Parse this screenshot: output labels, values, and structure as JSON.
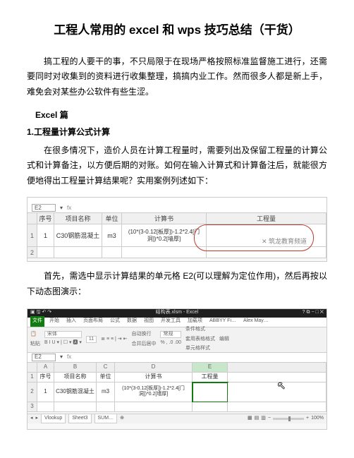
{
  "title": "工程人常用的 excel 和 wps 技巧总结（干货）",
  "para1": "搞工程的人要干的事，不只局限于在现场严格按照标准监督施工进行，还需要同时对收集到的资料进行收集整理，搞搞内业工作。然而很多人都是新上手，难免会对某些办公软件有些生涩。",
  "section1": "Excel 篇",
  "subsection1": "1.工程量计算公式计算",
  "para2": "在很多情况下，造价人员在计算工程量时，需要列出及保留工程量的计算公式和计算备注，以方便后期的对账。如何在输入计算式和计算备注后，就能很方便地得出工程量计算结果呢？实用案例列述如下：",
  "para3": "首先，需选中显示计算结果的单元格 E2(可以理解为定位作用)，然后再按以下动态图演示：",
  "ss1": {
    "cellref": "E2",
    "headers": [
      "序号",
      "项目名称",
      "单位",
      "计算书",
      "工程量"
    ],
    "row1": {
      "num": "1",
      "name": "C30钢筋混凝土",
      "unit": "m3",
      "formula": "(10*(3-0.12[板厚])-1.2*2.4[门洞])*0.2[墙厚]",
      "qty": ""
    },
    "watermark": "✕ 筑龙教育频道"
  },
  "ss2": {
    "windowtitle": "结构表.xlsm - Excel",
    "winbtns": "? ⧉ − □ ✕",
    "tabs": [
      "文件",
      "开始",
      "插入",
      "页面布局",
      "公式",
      "数据",
      "视图",
      "开发工具",
      "加载项",
      "ABBYY Fi…",
      "Alex May…"
    ],
    "ribbon": {
      "paste": "粘贴",
      "font": "宋体",
      "size": "11",
      "wrap": "自动换行",
      "merge": "合并后居中",
      "general": "常规",
      "cond": "条件格式",
      "table": "套用表格格式",
      "cellstyle": "单元格样式",
      "edit": "编辑"
    },
    "cellref": "E2",
    "collabels": [
      "",
      "A",
      "B",
      "C",
      "D",
      "E",
      ""
    ],
    "headers": [
      "序号",
      "项目名称",
      "单位",
      "计算书",
      "工程量"
    ],
    "row1": {
      "num": "1",
      "name": "C30钢筋混凝土",
      "unit": "m3",
      "formula": "(10*(3-0.12[板厚])-1.2*2.4[门洞])*0.2[墙厚]",
      "qty": ""
    },
    "sheettabs": [
      "Vlookup",
      "Sheet3",
      "SUM…"
    ],
    "zoom": "100%"
  }
}
